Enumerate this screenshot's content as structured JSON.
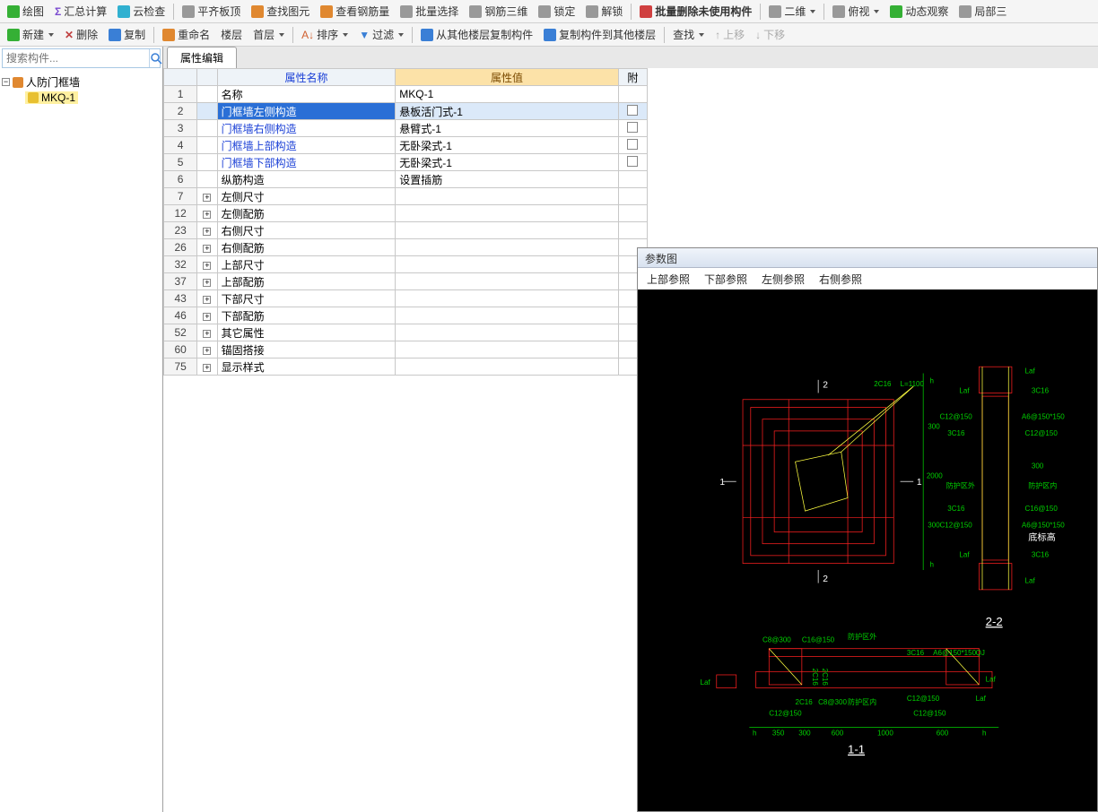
{
  "toolbar1": {
    "draw": "绘图",
    "sum": "汇总计算",
    "cloud": "云检查",
    "level": "平齐板顶",
    "find_elem": "查找图元",
    "view_rebar": "查看钢筋量",
    "batch_sel": "批量选择",
    "rebar_3d": "钢筋三维",
    "lock": "锁定",
    "unlock": "解锁",
    "batch_del": "批量删除未使用构件",
    "two_d": "二维",
    "look": "俯视",
    "dyn": "动态观察",
    "local": "局部三"
  },
  "toolbar2": {
    "new": "新建",
    "del": "删除",
    "copy": "复制",
    "rename": "重命名",
    "floor": "楼层",
    "floor_val": "首层",
    "sort": "排序",
    "filter": "过滤",
    "copy_from": "从其他楼层复制构件",
    "copy_to": "复制构件到其他楼层",
    "find": "查找",
    "up": "上移",
    "down": "下移"
  },
  "search": {
    "placeholder": "搜索构件..."
  },
  "tree": {
    "root": "人防门框墙",
    "child": "MKQ-1"
  },
  "tab": {
    "label": "属性编辑"
  },
  "grid": {
    "headers": {
      "name": "属性名称",
      "value": "属性值",
      "extra": "附"
    },
    "rows": [
      {
        "n": "1",
        "name": "名称",
        "val": "MKQ-1",
        "black": true
      },
      {
        "n": "2",
        "name": "门框墙左侧构造",
        "val": "悬板活门式-1",
        "chk": true,
        "sel": true
      },
      {
        "n": "3",
        "name": "门框墙右侧构造",
        "val": "悬臂式-1",
        "chk": true
      },
      {
        "n": "4",
        "name": "门框墙上部构造",
        "val": "无卧梁式-1",
        "chk": true
      },
      {
        "n": "5",
        "name": "门框墙下部构造",
        "val": "无卧梁式-1",
        "chk": true
      },
      {
        "n": "6",
        "name": "纵筋构造",
        "val": "设置插筋",
        "black": true
      },
      {
        "n": "7",
        "name": "左侧尺寸",
        "exp": true,
        "black": true
      },
      {
        "n": "12",
        "name": "左侧配筋",
        "exp": true,
        "black": true
      },
      {
        "n": "23",
        "name": "右侧尺寸",
        "exp": true,
        "black": true
      },
      {
        "n": "26",
        "name": "右侧配筋",
        "exp": true,
        "black": true
      },
      {
        "n": "32",
        "name": "上部尺寸",
        "exp": true,
        "black": true
      },
      {
        "n": "37",
        "name": "上部配筋",
        "exp": true,
        "black": true
      },
      {
        "n": "43",
        "name": "下部尺寸",
        "exp": true,
        "black": true
      },
      {
        "n": "46",
        "name": "下部配筋",
        "exp": true,
        "black": true
      },
      {
        "n": "52",
        "name": "其它属性",
        "exp": true,
        "black": true
      },
      {
        "n": "60",
        "name": "锚固搭接",
        "exp": true,
        "black": true
      },
      {
        "n": "75",
        "name": "显示样式",
        "exp": true,
        "black": true
      }
    ]
  },
  "param": {
    "title": "参数图",
    "tabs": [
      "上部参照",
      "下部参照",
      "左侧参照",
      "右侧参照"
    ],
    "labels": {
      "l2c16": "2C16",
      "l1100": "L=1100",
      "h": "h",
      "d300": "300",
      "d2000": "2000",
      "laf": "Laf",
      "l3c16": "3C16",
      "c12_150": "C12@150",
      "a6_150": "A6@150*150",
      "c16_150": "C16@150",
      "zone_out": "防护区外",
      "zone_in": "防护区内",
      "base": "底标高",
      "sec22": "2-2",
      "sec11": "1-1",
      "c8_300": "C8@300",
      "c16_150b": "C16@150",
      "d350": "350",
      "d600": "600",
      "d1000": "1000",
      "l2c16b": "2C16",
      "qj": "QJ"
    }
  }
}
